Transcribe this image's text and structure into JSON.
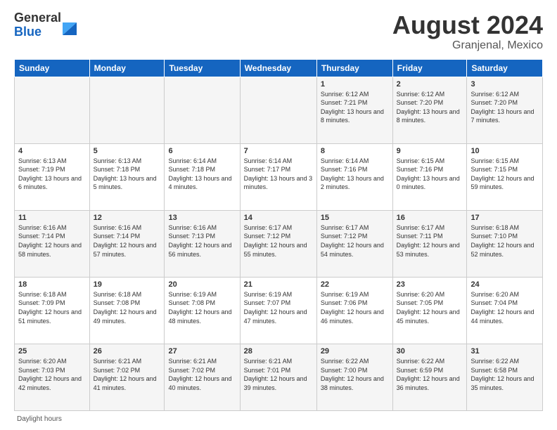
{
  "logo": {
    "general": "General",
    "blue": "Blue"
  },
  "title": "August 2024",
  "location": "Granjenal, Mexico",
  "days_of_week": [
    "Sunday",
    "Monday",
    "Tuesday",
    "Wednesday",
    "Thursday",
    "Friday",
    "Saturday"
  ],
  "footer": "Daylight hours",
  "weeks": [
    [
      {
        "day": "",
        "info": ""
      },
      {
        "day": "",
        "info": ""
      },
      {
        "day": "",
        "info": ""
      },
      {
        "day": "",
        "info": ""
      },
      {
        "day": "1",
        "info": "Sunrise: 6:12 AM\nSunset: 7:21 PM\nDaylight: 13 hours\nand 8 minutes."
      },
      {
        "day": "2",
        "info": "Sunrise: 6:12 AM\nSunset: 7:20 PM\nDaylight: 13 hours\nand 8 minutes."
      },
      {
        "day": "3",
        "info": "Sunrise: 6:12 AM\nSunset: 7:20 PM\nDaylight: 13 hours\nand 7 minutes."
      }
    ],
    [
      {
        "day": "4",
        "info": "Sunrise: 6:13 AM\nSunset: 7:19 PM\nDaylight: 13 hours\nand 6 minutes."
      },
      {
        "day": "5",
        "info": "Sunrise: 6:13 AM\nSunset: 7:18 PM\nDaylight: 13 hours\nand 5 minutes."
      },
      {
        "day": "6",
        "info": "Sunrise: 6:14 AM\nSunset: 7:18 PM\nDaylight: 13 hours\nand 4 minutes."
      },
      {
        "day": "7",
        "info": "Sunrise: 6:14 AM\nSunset: 7:17 PM\nDaylight: 13 hours\nand 3 minutes."
      },
      {
        "day": "8",
        "info": "Sunrise: 6:14 AM\nSunset: 7:16 PM\nDaylight: 13 hours\nand 2 minutes."
      },
      {
        "day": "9",
        "info": "Sunrise: 6:15 AM\nSunset: 7:16 PM\nDaylight: 13 hours\nand 0 minutes."
      },
      {
        "day": "10",
        "info": "Sunrise: 6:15 AM\nSunset: 7:15 PM\nDaylight: 12 hours\nand 59 minutes."
      }
    ],
    [
      {
        "day": "11",
        "info": "Sunrise: 6:16 AM\nSunset: 7:14 PM\nDaylight: 12 hours\nand 58 minutes."
      },
      {
        "day": "12",
        "info": "Sunrise: 6:16 AM\nSunset: 7:14 PM\nDaylight: 12 hours\nand 57 minutes."
      },
      {
        "day": "13",
        "info": "Sunrise: 6:16 AM\nSunset: 7:13 PM\nDaylight: 12 hours\nand 56 minutes."
      },
      {
        "day": "14",
        "info": "Sunrise: 6:17 AM\nSunset: 7:12 PM\nDaylight: 12 hours\nand 55 minutes."
      },
      {
        "day": "15",
        "info": "Sunrise: 6:17 AM\nSunset: 7:12 PM\nDaylight: 12 hours\nand 54 minutes."
      },
      {
        "day": "16",
        "info": "Sunrise: 6:17 AM\nSunset: 7:11 PM\nDaylight: 12 hours\nand 53 minutes."
      },
      {
        "day": "17",
        "info": "Sunrise: 6:18 AM\nSunset: 7:10 PM\nDaylight: 12 hours\nand 52 minutes."
      }
    ],
    [
      {
        "day": "18",
        "info": "Sunrise: 6:18 AM\nSunset: 7:09 PM\nDaylight: 12 hours\nand 51 minutes."
      },
      {
        "day": "19",
        "info": "Sunrise: 6:18 AM\nSunset: 7:08 PM\nDaylight: 12 hours\nand 49 minutes."
      },
      {
        "day": "20",
        "info": "Sunrise: 6:19 AM\nSunset: 7:08 PM\nDaylight: 12 hours\nand 48 minutes."
      },
      {
        "day": "21",
        "info": "Sunrise: 6:19 AM\nSunset: 7:07 PM\nDaylight: 12 hours\nand 47 minutes."
      },
      {
        "day": "22",
        "info": "Sunrise: 6:19 AM\nSunset: 7:06 PM\nDaylight: 12 hours\nand 46 minutes."
      },
      {
        "day": "23",
        "info": "Sunrise: 6:20 AM\nSunset: 7:05 PM\nDaylight: 12 hours\nand 45 minutes."
      },
      {
        "day": "24",
        "info": "Sunrise: 6:20 AM\nSunset: 7:04 PM\nDaylight: 12 hours\nand 44 minutes."
      }
    ],
    [
      {
        "day": "25",
        "info": "Sunrise: 6:20 AM\nSunset: 7:03 PM\nDaylight: 12 hours\nand 42 minutes."
      },
      {
        "day": "26",
        "info": "Sunrise: 6:21 AM\nSunset: 7:02 PM\nDaylight: 12 hours\nand 41 minutes."
      },
      {
        "day": "27",
        "info": "Sunrise: 6:21 AM\nSunset: 7:02 PM\nDaylight: 12 hours\nand 40 minutes."
      },
      {
        "day": "28",
        "info": "Sunrise: 6:21 AM\nSunset: 7:01 PM\nDaylight: 12 hours\nand 39 minutes."
      },
      {
        "day": "29",
        "info": "Sunrise: 6:22 AM\nSunset: 7:00 PM\nDaylight: 12 hours\nand 38 minutes."
      },
      {
        "day": "30",
        "info": "Sunrise: 6:22 AM\nSunset: 6:59 PM\nDaylight: 12 hours\nand 36 minutes."
      },
      {
        "day": "31",
        "info": "Sunrise: 6:22 AM\nSunset: 6:58 PM\nDaylight: 12 hours\nand 35 minutes."
      }
    ]
  ]
}
